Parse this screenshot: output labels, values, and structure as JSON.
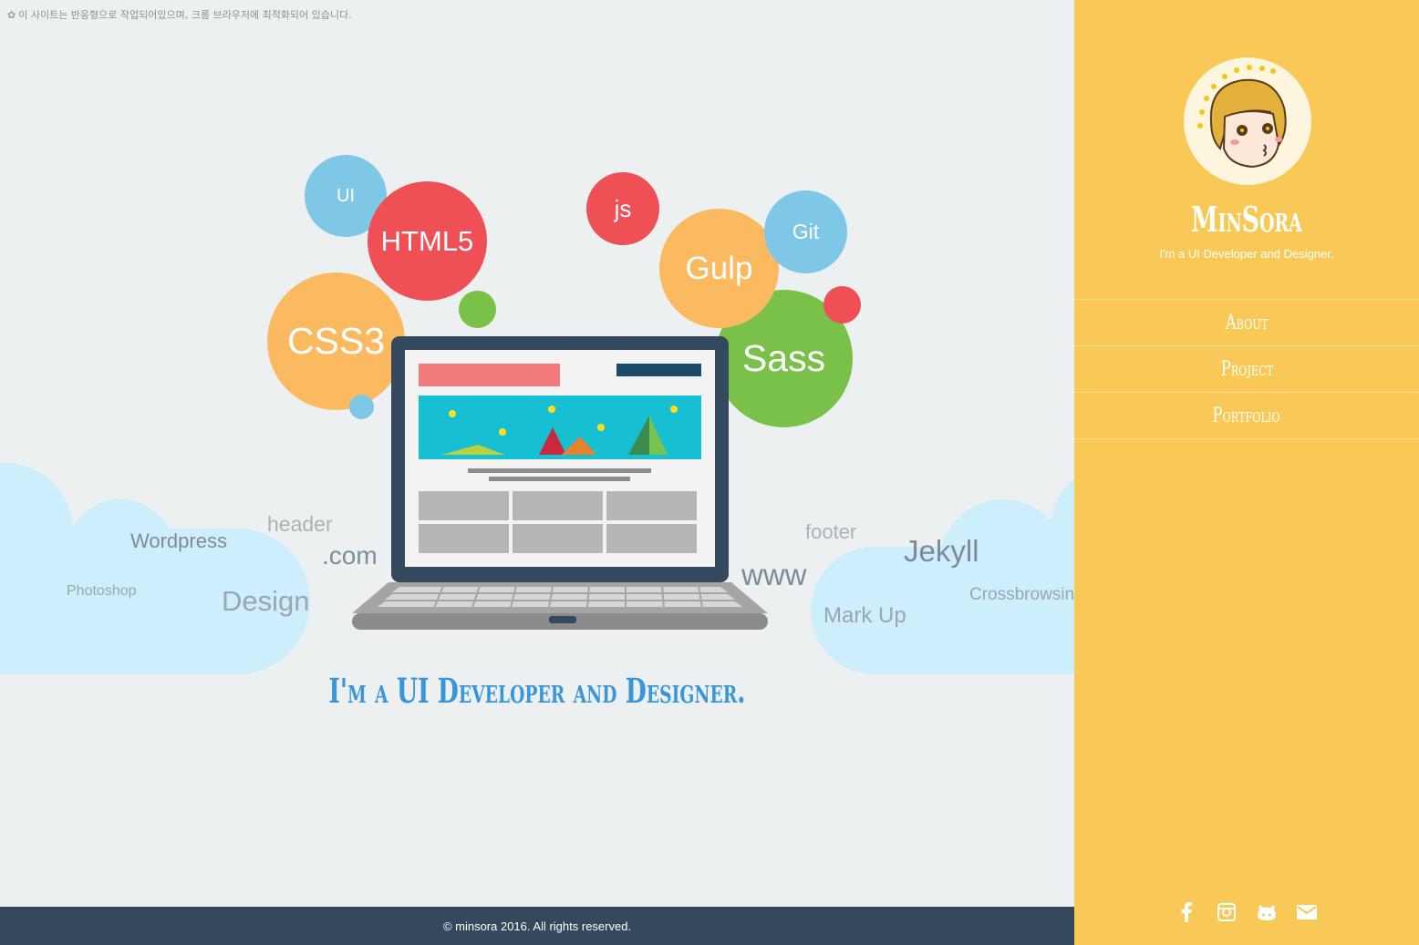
{
  "notice": {
    "icon": "gear-icon",
    "text": "이 사이트는 반응형으로 작업되어있으며, 크롬 브라우저에 최적화되어 있습니다."
  },
  "bubbles": [
    {
      "label": "UI",
      "color": "#7fc7e6"
    },
    {
      "label": "HTML5",
      "color": "#ef5055"
    },
    {
      "label": "CSS3",
      "color": "#fcba60"
    },
    {
      "label": "js",
      "color": "#ef5055"
    },
    {
      "label": "Gulp",
      "color": "#fcba60"
    },
    {
      "label": "Git",
      "color": "#7fc7e6"
    },
    {
      "label": "Sass",
      "color": "#79c148"
    }
  ],
  "words": {
    "header": "header",
    "wordpress": "Wordpress",
    "com": ".com",
    "photoshop": "Photoshop",
    "design": "Design",
    "footer": "footer",
    "jekyll": "Jekyll",
    "www": "www",
    "crossbrowsing": "Crossbrowsing",
    "markup": "Mark Up"
  },
  "tagline": "I'm a UI Developer and Designer.",
  "footer": {
    "copyright": "© minsora 2016. All rights reserved.",
    "background": "#34495e"
  },
  "sidebar": {
    "background": "#f8c956",
    "brand": "MinSora",
    "subtitle": "I'm a UI Developer and Designer.",
    "nav": [
      {
        "label": "About"
      },
      {
        "label": "Project"
      },
      {
        "label": "Portfolio"
      }
    ],
    "social": [
      {
        "icon": "facebook-icon"
      },
      {
        "icon": "instagram-icon"
      },
      {
        "icon": "github-icon"
      },
      {
        "icon": "mail-icon"
      }
    ]
  }
}
